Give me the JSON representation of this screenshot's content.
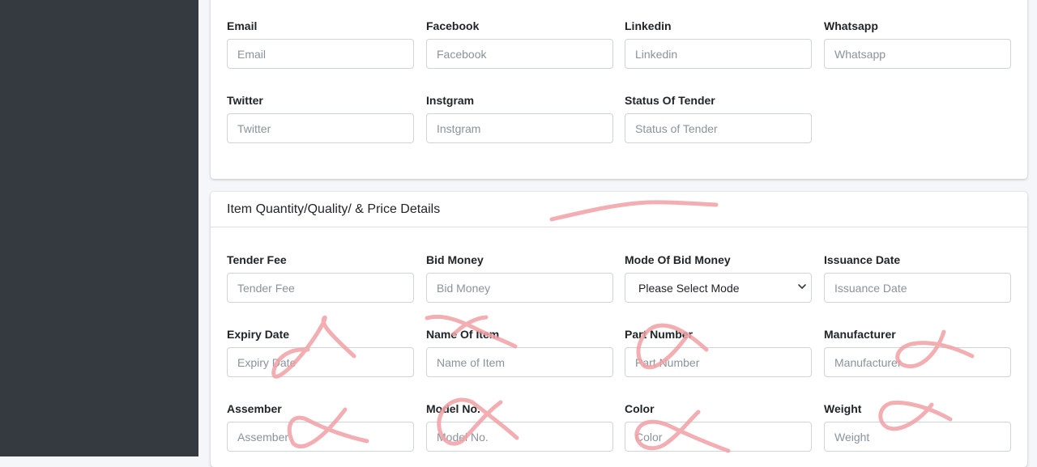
{
  "contact_section": {
    "fields": [
      {
        "label": "Email",
        "placeholder": "Email"
      },
      {
        "label": "Facebook",
        "placeholder": "Facebook"
      },
      {
        "label": "Linkedin",
        "placeholder": "Linkedin"
      },
      {
        "label": "Whatsapp",
        "placeholder": "Whatsapp"
      },
      {
        "label": "Twitter",
        "placeholder": "Twitter"
      },
      {
        "label": "Instgram",
        "placeholder": "Instgram"
      },
      {
        "label": "Status Of Tender",
        "placeholder": "Status of Tender"
      }
    ]
  },
  "item_section": {
    "title": "Item Quantity/Quality/ & Price Details",
    "fields": [
      {
        "label": "Tender Fee",
        "placeholder": "Tender Fee"
      },
      {
        "label": "Bid Money",
        "placeholder": "Bid Money"
      },
      {
        "label": "Mode Of Bid Money",
        "selected": "Please Select Mode"
      },
      {
        "label": "Issuance Date",
        "placeholder": "Issuance Date"
      },
      {
        "label": "Expiry Date",
        "placeholder": "Expiry Date"
      },
      {
        "label": "Name Of Item",
        "placeholder": "Name of Item"
      },
      {
        "label": "Part Number",
        "placeholder": "Part Number"
      },
      {
        "label": "Manufacturer",
        "placeholder": "Manufacturer"
      },
      {
        "label": "Assember",
        "placeholder": "Assember"
      },
      {
        "label": "Model No.",
        "placeholder": "Model No."
      },
      {
        "label": "Color",
        "placeholder": "Color"
      },
      {
        "label": "Weight",
        "placeholder": "Weight"
      }
    ]
  },
  "colors": {
    "sidebar": "#343a40",
    "background": "#f4f6f9",
    "annotation_marks": "#f0a0a4"
  }
}
